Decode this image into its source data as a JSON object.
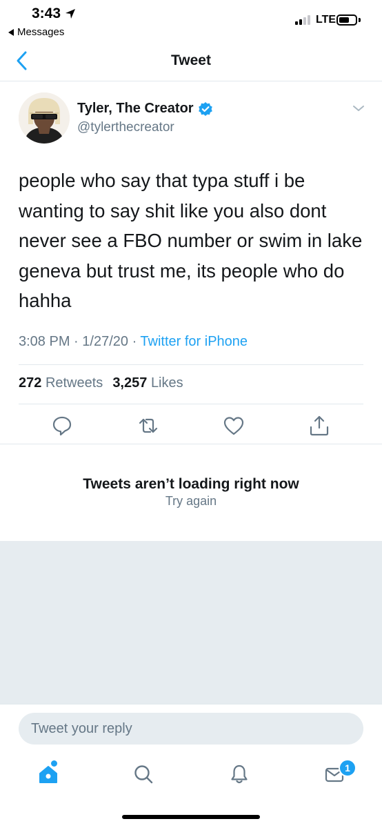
{
  "status_bar": {
    "time": "3:43",
    "back_app": "Messages",
    "network": "LTE"
  },
  "nav": {
    "title": "Tweet"
  },
  "tweet": {
    "author_name": "Tyler, The Creator",
    "author_handle": "@tylerthecreator",
    "verified": true,
    "text": "people who say that typa stuff i be wanting to say shit like you also dont never see a FBO number or swim in lake geneva but trust me, its people who do hahha",
    "time": "3:08 PM",
    "date": "1/27/20",
    "source": "Twitter for iPhone",
    "retweets_count": "272",
    "retweets_label": "Retweets",
    "likes_count": "3,257",
    "likes_label": "Likes"
  },
  "error": {
    "title": "Tweets aren’t loading right now",
    "action": "Try again"
  },
  "reply": {
    "placeholder": "Tweet your reply"
  },
  "tab_bar": {
    "items": [
      "home-icon",
      "search-icon",
      "notifications-icon",
      "messages-icon"
    ],
    "messages_badge": "1"
  },
  "colors": {
    "accent": "#1da1f2",
    "text": "#14171a",
    "secondary": "#657786",
    "divider": "#e1e8ed",
    "background_gray": "#e6ecf0"
  }
}
